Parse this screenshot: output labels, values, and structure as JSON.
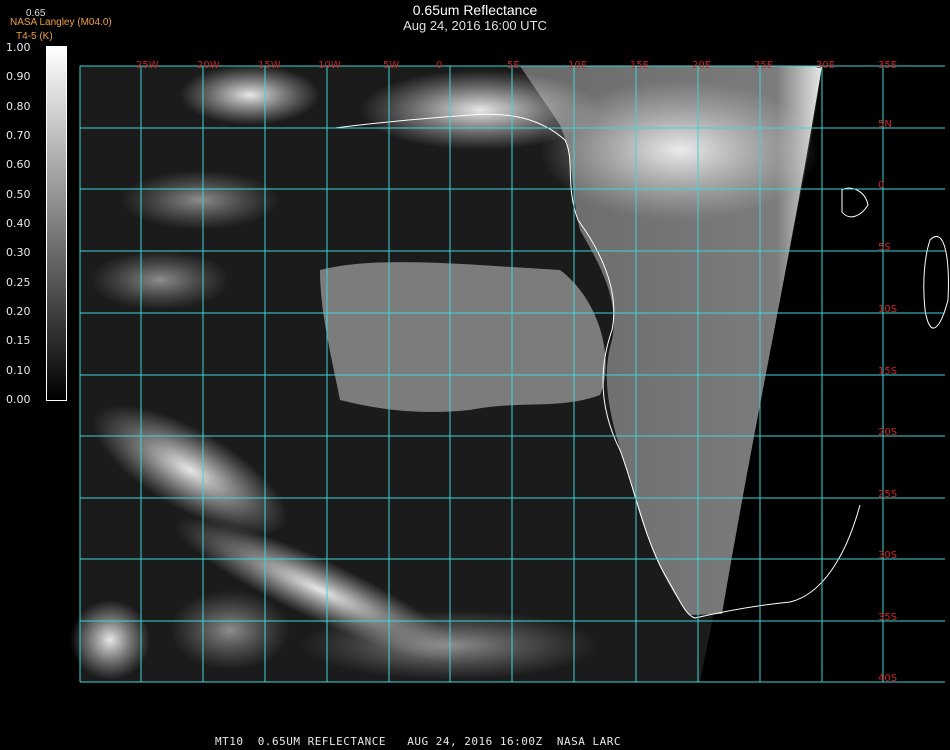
{
  "header": {
    "title": "0.65um Reflectance",
    "subtitle": "Aug 24, 2016 16:00 UTC",
    "brand_line1": "NASA Langley (M04.0)",
    "brand_line2": "T4-5 (K)",
    "colorbar_top": "0.65"
  },
  "colorbar": {
    "ticks": [
      "1.00",
      "0.90",
      "0.80",
      "0.70",
      "0.60",
      "0.50",
      "0.40",
      "0.30",
      "0.25",
      "0.20",
      "0.15",
      "0.10",
      "0.00"
    ]
  },
  "map": {
    "lon_labels": [
      "25W",
      "20W",
      "15W",
      "10W",
      "5W",
      "0",
      "5E",
      "10E",
      "15E",
      "20E",
      "25E",
      "30E",
      "35E"
    ],
    "lat_labels": [
      "5N",
      "0",
      "5S",
      "10S",
      "15S",
      "20S",
      "25S",
      "30S",
      "35S",
      "40S"
    ],
    "grid_color": "#3ad6d6",
    "label_color": "#d22222",
    "coast_color": "#ffffff"
  },
  "footer": {
    "text": "MT10  0.65UM REFLECTANCE   AUG 24, 2016 16:00Z  NASA LARC"
  }
}
